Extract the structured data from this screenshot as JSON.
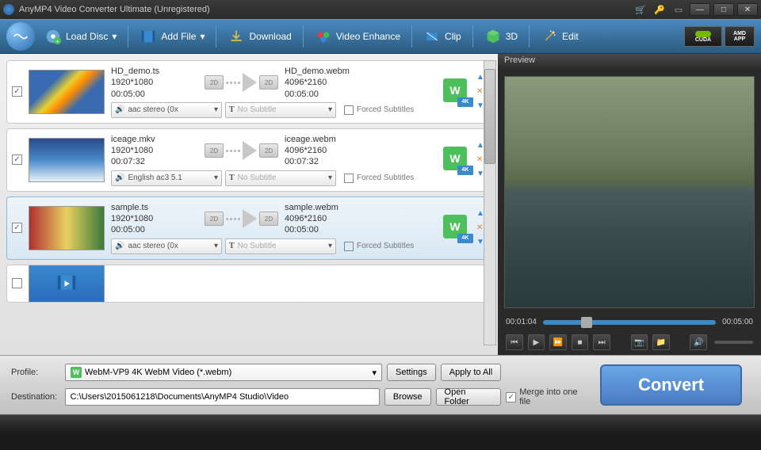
{
  "window": {
    "title": "AnyMP4 Video Converter Ultimate (Unregistered)"
  },
  "toolbar": {
    "load_disc": "Load Disc",
    "add_file": "Add File",
    "download": "Download",
    "video_enhance": "Video Enhance",
    "clip": "Clip",
    "three_d": "3D",
    "edit": "Edit",
    "cuda": "CUDA",
    "amd": "APP",
    "amd_label": "AMD"
  },
  "files": [
    {
      "checked": true,
      "src_name": "HD_demo.ts",
      "src_res": "1920*1080",
      "src_dur": "00:05:00",
      "dst_name": "HD_demo.webm",
      "dst_res": "4096*2160",
      "dst_dur": "00:05:00",
      "audio": "aac stereo (0x",
      "subtitle": "No Subtitle",
      "forced": "Forced Subtitles",
      "badge": "W",
      "badge_4k": "4K"
    },
    {
      "checked": true,
      "src_name": "iceage.mkv",
      "src_res": "1920*1080",
      "src_dur": "00:07:32",
      "dst_name": "iceage.webm",
      "dst_res": "4096*2160",
      "dst_dur": "00:07:32",
      "audio": "English ac3 5.1",
      "subtitle": "No Subtitle",
      "forced": "Forced Subtitles",
      "badge": "W",
      "badge_4k": "4K"
    },
    {
      "checked": true,
      "src_name": "sample.ts",
      "src_res": "1920*1080",
      "src_dur": "00:05:00",
      "dst_name": "sample.webm",
      "dst_res": "4096*2160",
      "dst_dur": "00:05:00",
      "audio": "aac stereo (0x",
      "subtitle": "No Subtitle",
      "forced": "Forced Subtitles",
      "badge": "W",
      "badge_4k": "4K"
    }
  ],
  "conv_labels": {
    "src_2d": "2D",
    "dst_2d": "2D"
  },
  "preview": {
    "label": "Preview",
    "cur_time": "00:01:04",
    "total_time": "00:05:00"
  },
  "bottom": {
    "profile_label": "Profile:",
    "profile_value": "WebM-VP9 4K WebM Video (*.webm)",
    "settings": "Settings",
    "apply_all": "Apply to All",
    "dest_label": "Destination:",
    "dest_value": "C:\\Users\\2015061218\\Documents\\AnyMP4 Studio\\Video",
    "browse": "Browse",
    "open_folder": "Open Folder",
    "merge": "Merge into one file",
    "convert": "Convert"
  }
}
